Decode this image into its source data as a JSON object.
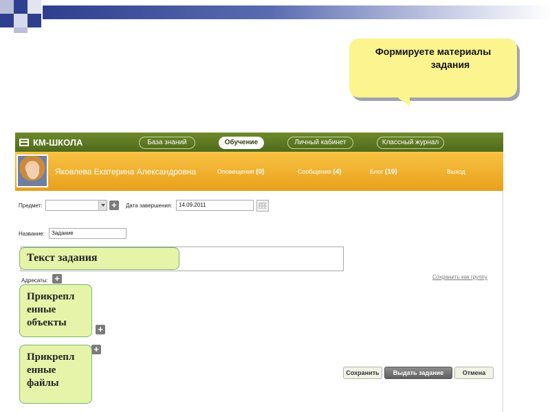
{
  "callout_top": {
    "line1": "Формируете материалы",
    "line2": "задания"
  },
  "app": {
    "brand": "КМ-ШКОЛА",
    "nav": [
      {
        "label": "База знаний",
        "active": false
      },
      {
        "label": "Обучение",
        "active": true
      },
      {
        "label": "Личный кабинет",
        "active": false
      },
      {
        "label": "Классный журнал",
        "active": false
      }
    ],
    "user": {
      "name": "Яковлева Екатерина Александровна",
      "notifications_label": "Оповещения",
      "notifications_count": "(0)",
      "messages_label": "Сообщения",
      "messages_count": "(4)",
      "blog_label": "Блог",
      "blog_count": "(10)",
      "logout": "Выход"
    },
    "form": {
      "subject_label": "Предмет:",
      "subject_value": "",
      "due_label": "Дата завершения:",
      "due_value": "14.09.2011",
      "title_label": "Название:",
      "title_value": "Задание",
      "addressees_label": "Адресаты:",
      "save_as_group": "Сохранить как группу"
    },
    "callouts": {
      "task_text": "Текст задания",
      "attached_objects": [
        "Прикрепл",
        "енные",
        "объекты"
      ],
      "attached_files": [
        "Прикрепл",
        "енные",
        "файлы"
      ]
    },
    "buttons": {
      "save": "Сохранить",
      "issue": "Выдать задание",
      "cancel": "Отмена"
    }
  }
}
